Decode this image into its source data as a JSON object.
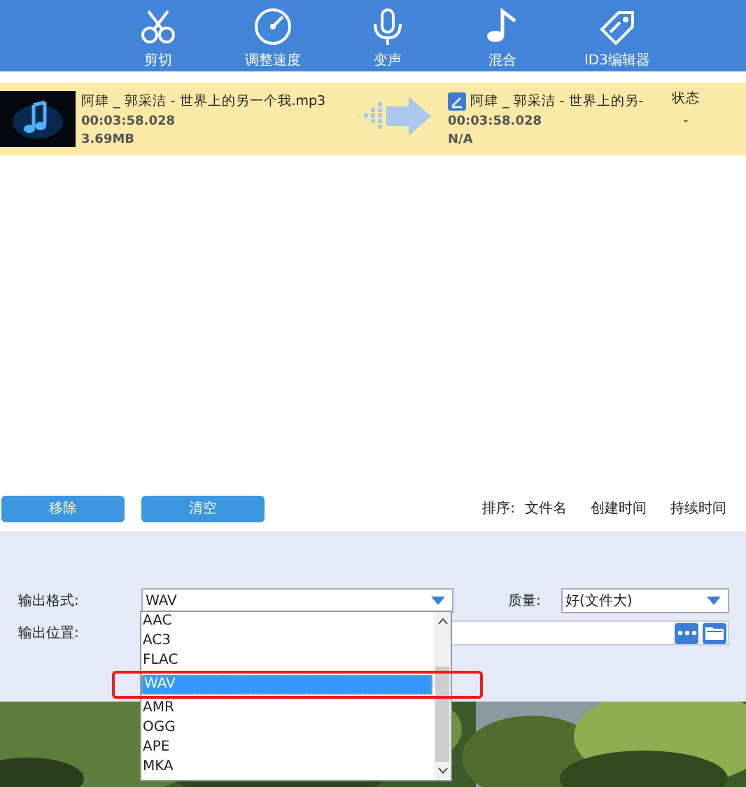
{
  "toolbar": {
    "items": [
      {
        "label": "剪切",
        "kind": "cut"
      },
      {
        "label": "调整速度",
        "kind": "speed"
      },
      {
        "label": "变声",
        "kind": "voice"
      },
      {
        "label": "混合",
        "kind": "mix"
      },
      {
        "label": "ID3编辑器",
        "kind": "tags"
      }
    ]
  },
  "file_row": {
    "selected": true,
    "source": {
      "name": "阿肆 _ 郭采洁 - 世界上的另一个我.mp3",
      "duration": "00:03:58.028",
      "size": "3.69MB"
    },
    "target": {
      "name": "阿肆 _ 郭采洁 - 世界上的另-",
      "duration": "00:03:58.028",
      "size": "N/A"
    },
    "status_header": "状态",
    "status": "-"
  },
  "buttons": [
    "移除",
    "清空"
  ],
  "sort": {
    "label": "排序:",
    "options": [
      "文件名",
      "创建时间",
      "持续时间"
    ]
  },
  "settings": {
    "format": {
      "label": "输出格式:",
      "value": "WAV"
    },
    "quality": {
      "label": "质量:",
      "value": "好(文件大)"
    },
    "location": {
      "label": "输出位置:"
    }
  },
  "dropdown": {
    "highlighted": true,
    "options": [
      {
        "label": "AAC",
        "selected": false
      },
      {
        "label": "AC3",
        "selected": false
      },
      {
        "label": "FLAC",
        "selected": false
      },
      {
        "label": "WAV",
        "selected": true
      },
      {
        "label": "AMR",
        "selected": false
      },
      {
        "label": "OGG",
        "selected": false
      },
      {
        "label": "APE",
        "selected": false
      },
      {
        "label": "MKA",
        "selected": false
      }
    ]
  }
}
